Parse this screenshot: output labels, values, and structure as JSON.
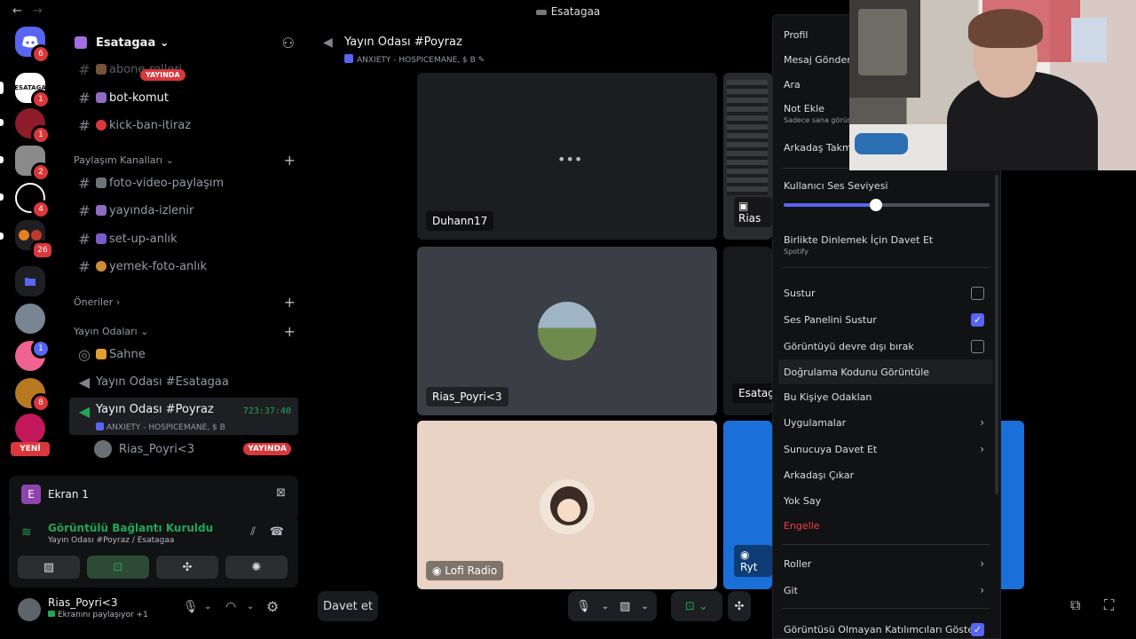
{
  "titlebar": {
    "title": "Esatagaa",
    "back": "←",
    "forward": "→"
  },
  "rail": {
    "servers": [
      {
        "name": "home",
        "badge": "6"
      },
      {
        "name": "esatagaa",
        "label": "ESATAGA",
        "badge": "1"
      },
      {
        "name": "server-3",
        "badge": "1"
      },
      {
        "name": "server-4",
        "badge": "2"
      },
      {
        "name": "server-5",
        "badge": "4"
      },
      {
        "name": "server-6",
        "badge": "26"
      },
      {
        "name": "folder"
      },
      {
        "name": "server-8"
      },
      {
        "name": "server-9",
        "badge": "1"
      },
      {
        "name": "server-10",
        "badge": "8"
      },
      {
        "name": "server-11"
      }
    ],
    "new_label": "YENİ"
  },
  "guild": {
    "name": "Esatagaa"
  },
  "channels": {
    "top": [
      {
        "name": "abone-rolleri"
      },
      {
        "name": "bot-komut"
      },
      {
        "name": "kick-ban-itiraz"
      }
    ],
    "overlay_tag": "YAYINDA",
    "cat_share": "Paylaşım Kanalları",
    "share": [
      {
        "name": "foto-video-paylaşım"
      },
      {
        "name": "yayında-izlenir"
      },
      {
        "name": "set-up-anlık"
      },
      {
        "name": "yemek-foto-anlık"
      }
    ],
    "cat_suggest": "Öneriler",
    "cat_stream": "Yayın Odaları",
    "stage": "Sahne",
    "room1": "Yayın Odası #Esatagaa",
    "room2": "Yayın Odası #Poyraz",
    "room2_timer": "723:37:40",
    "room2_activity": "ANXIETY - HOSPICEMANE, $ B",
    "member": "Rias_Poyri<3",
    "member_live": "YAYINDA"
  },
  "screen_panel": {
    "icon_letter": "E",
    "title": "Ekran 1"
  },
  "voice_panel": {
    "status": "Görüntülü Bağlantı Kuruldu",
    "location": "Yayın Odası #Poyraz / Esatagaa"
  },
  "user": {
    "name": "Rias_Poyri<3",
    "status": "Ekranını paylaşıyor +1"
  },
  "header": {
    "title": "Yayın Odası #Poyraz",
    "activity": "ANXIETY - HOSPICEMANE, $ B"
  },
  "tiles": {
    "t1": "Duhann17",
    "t2": "Rias",
    "t3": "Rias_Poyri<3",
    "t4": "Esatag",
    "t5": "Lofi Radio",
    "t6": "Ryt"
  },
  "bottom": {
    "invite": "Davet et"
  },
  "menu": {
    "profile": "Profil",
    "message": "Mesaj Gönder",
    "call": "Ara",
    "note": "Not Ekle",
    "note_sub": "Sadece sana görünür",
    "nickname": "Arkadaş Takma Adı",
    "volume_label": "Kullanıcı Ses Seviyesi",
    "volume": 0.45,
    "listen": "Birlikte Dinlemek İçin Davet Et",
    "listen_sub": "Spotify",
    "mute": "Sustur",
    "mute_checked": false,
    "mute_soundboard": "Ses Panelini Sustur",
    "mute_soundboard_checked": true,
    "disable_video": "Görüntüyü devre dışı bırak",
    "disable_video_checked": false,
    "verify_code": "Doğrulama Kodunu Görüntüle",
    "focus": "Bu Kişiye Odaklan",
    "apps": "Uygulamalar",
    "invite_server": "Sunucuya Davet Et",
    "remove_friend": "Arkadaşı Çıkar",
    "ignore": "Yok Say",
    "block": "Engelle",
    "roles": "Roller",
    "go": "Git",
    "show_non_video": "Görüntüsü Olmayan Katılımcıları Göster",
    "show_non_video_checked": true
  },
  "colors": {
    "accent": "#5865f2",
    "danger": "#da373c",
    "online": "#23a55a"
  }
}
